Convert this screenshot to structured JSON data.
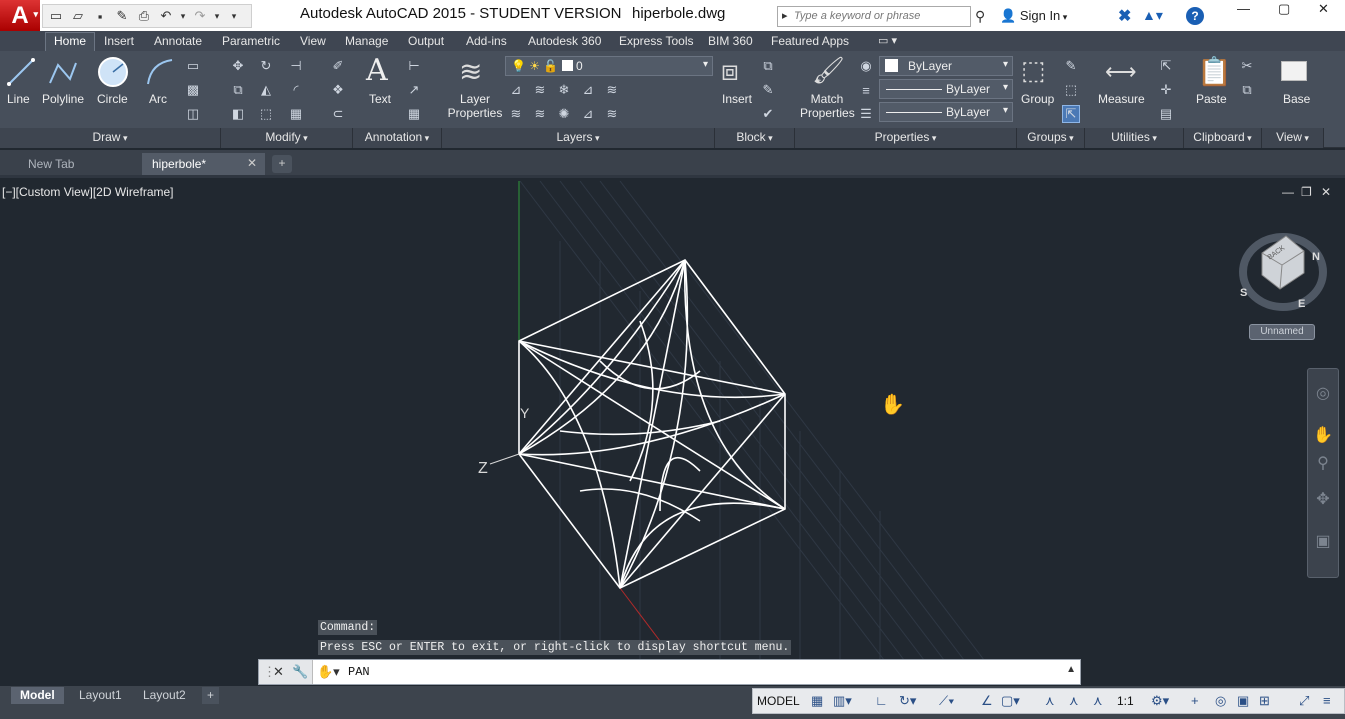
{
  "title": {
    "app": "Autodesk AutoCAD 2015 - STUDENT VERSION",
    "file": "hiperbole.dwg"
  },
  "search": {
    "placeholder": "Type a keyword or phrase"
  },
  "account": {
    "sign_in": "Sign In"
  },
  "ribbon_tabs": [
    "Home",
    "Insert",
    "Annotate",
    "Parametric",
    "View",
    "Manage",
    "Output",
    "Add-ins",
    "Autodesk 360",
    "Express Tools",
    "BIM 360",
    "Featured Apps"
  ],
  "draw": {
    "line": "Line",
    "polyline": "Polyline",
    "circle": "Circle",
    "arc": "Arc",
    "panel": "Draw"
  },
  "modify": {
    "panel": "Modify"
  },
  "annotation": {
    "text": "Text",
    "panel": "Annotation"
  },
  "layers": {
    "properties": "Layer Properties",
    "current_layer": "0",
    "panel": "Layers"
  },
  "block": {
    "insert": "Insert",
    "panel": "Block"
  },
  "properties": {
    "match": "Match Properties",
    "color": "ByLayer",
    "linetype": "ByLayer",
    "lineweight": "ByLayer",
    "panel": "Properties"
  },
  "groups": {
    "group": "Group",
    "panel": "Groups"
  },
  "utilities": {
    "measure": "Measure",
    "panel": "Utilities"
  },
  "clipboard": {
    "paste": "Paste",
    "panel": "Clipboard"
  },
  "view_panel": {
    "base": "Base",
    "panel": "View"
  },
  "doc_tabs": {
    "new_tab": "New Tab",
    "active": "hiperbole*"
  },
  "viewport": {
    "label": "[−][Custom View][2D Wireframe]",
    "named_view": "Unnamed",
    "viewcube": {
      "face": "BACK",
      "compass": [
        "S",
        "E",
        "N"
      ]
    },
    "axes": {
      "y": "Y",
      "z": "Z"
    }
  },
  "command": {
    "history": [
      "Command:",
      "Press ESC or ENTER to exit, or right-click to display shortcut menu."
    ],
    "current": "PAN"
  },
  "layouts": [
    "Model",
    "Layout1",
    "Layout2"
  ],
  "status": {
    "model": "MODEL",
    "scale": "1:1"
  }
}
